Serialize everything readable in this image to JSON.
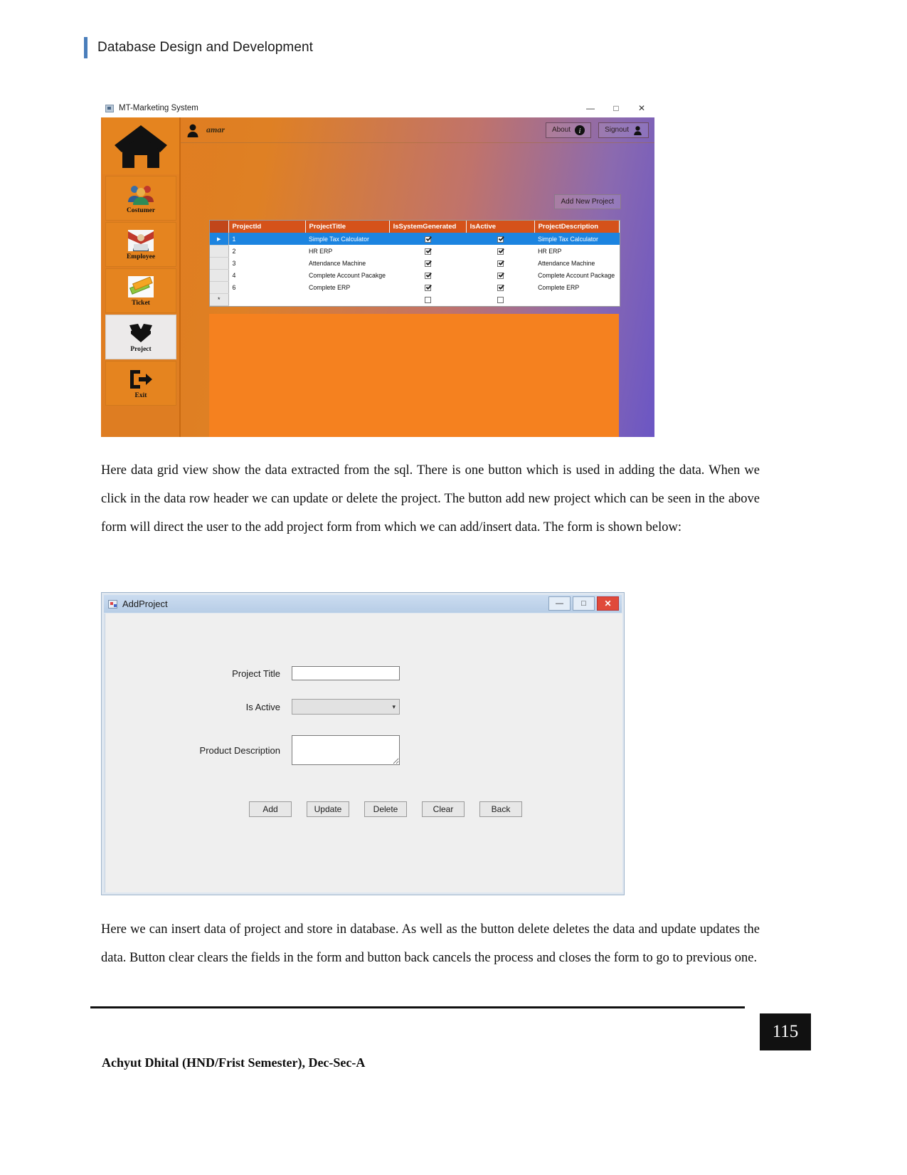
{
  "running_head": "Database Design and Development",
  "figure1": {
    "window_title": "MT-Marketing System",
    "win_minimize": "—",
    "win_maximize": "□",
    "win_close": "✕",
    "username": "amar",
    "about_label": "About",
    "signout_label": "Signout",
    "add_new_project_label": "Add New Project",
    "sidebar": [
      {
        "label": "Costumer",
        "icon": "people-icon",
        "selected": false
      },
      {
        "label": "Employee",
        "icon": "employee-icon",
        "selected": false
      },
      {
        "label": "Ticket",
        "icon": "ticket-icon",
        "selected": false
      },
      {
        "label": "Project",
        "icon": "box-icon",
        "selected": true
      },
      {
        "label": "Exit",
        "icon": "exit-icon",
        "selected": false
      }
    ],
    "grid": {
      "columns": [
        "ProjectId",
        "ProjectTitle",
        "IsSystemGenerated",
        "IsActive",
        "ProjectDescription"
      ],
      "rows": [
        {
          "id": "1",
          "title": "Simple Tax Calculator",
          "sysgen": true,
          "active": true,
          "desc": "Simple Tax Calculator",
          "selected": true
        },
        {
          "id": "2",
          "title": "HR ERP",
          "sysgen": true,
          "active": true,
          "desc": "HR ERP",
          "selected": false
        },
        {
          "id": "3",
          "title": "Attendance Machine",
          "sysgen": true,
          "active": true,
          "desc": "Attendance Machine",
          "selected": false
        },
        {
          "id": "4",
          "title": "Complete Account Pacakge",
          "sysgen": true,
          "active": true,
          "desc": "Complete Account Package",
          "selected": false
        },
        {
          "id": "6",
          "title": "Complete ERP",
          "sysgen": true,
          "active": true,
          "desc": "Complete ERP",
          "selected": false
        },
        {
          "id": "",
          "title": "",
          "sysgen": false,
          "active": false,
          "desc": "",
          "selected": false
        }
      ]
    }
  },
  "paragraph1": "Here data grid view show the data extracted from the sql. There is one button which is used in adding the data. When we click in the data row header we can update or delete the project. The button add new project which can be seen in the above form will direct the user to the add project form from which we can add/insert data. The form is shown below:",
  "figure2": {
    "window_title": "AddProject",
    "win_minimize": "—",
    "win_maximize": "□",
    "win_close": "✕",
    "labels": {
      "project_title": "Project Title",
      "is_active": "Is Active",
      "product_description": "Product Description"
    },
    "project_title_value": "",
    "is_active_value": "",
    "product_description_value": "",
    "combo_arrow": "▾",
    "buttons": [
      "Add",
      "Update",
      "Delete",
      "Clear",
      "Back"
    ]
  },
  "paragraph2": "Here we can insert data of project and store in database. As well as the button delete deletes the data and update updates the data. Button clear clears the fields in the form and button back cancels the process and closes the form to go to previous one.",
  "footer": {
    "page_number": "115",
    "author_line": "Achyut Dhital (HND/Frist Semester), Dec-Sec-A"
  },
  "colors": {
    "accent": "#4a7ebb",
    "orange": "#e5841f",
    "grid_header": "#d5521a",
    "selection": "#1c84e0"
  }
}
